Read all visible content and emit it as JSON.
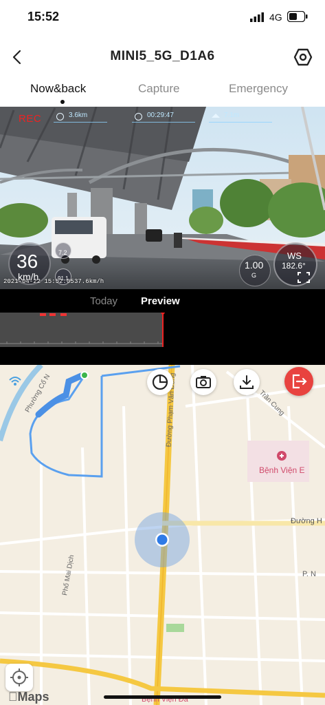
{
  "status_bar": {
    "time": "15:52",
    "network": "4G"
  },
  "header": {
    "title": "MINI5_5G_D1A6"
  },
  "tabs": [
    {
      "label": "Now&back",
      "active": true
    },
    {
      "label": "Capture",
      "active": false
    },
    {
      "label": "Emergency",
      "active": false
    }
  ],
  "video": {
    "rec_label": "REC",
    "distance": "3.6km",
    "elapsed": "00:29:47",
    "altitude": "7.1m",
    "speed": "36",
    "speed_unit": "km/h",
    "small_gauge_a": "7.2",
    "small_gauge_b": "91.1",
    "timestamp": "2021-04-22 15:52:05",
    "speed_text": "37.6km/h",
    "gforce": "1.00",
    "gforce_unit": "G",
    "compass_direction": "WS",
    "compass_heading": "182.6°"
  },
  "timeline": {
    "today_label": "Today",
    "preview_label": "Preview"
  },
  "map": {
    "labels": {
      "pham_van_dong": "Đường Phạm Văn Đồng",
      "tran_cung": "Trần Cung",
      "benh_vien_e": "Bệnh Viện E",
      "duong_h": "Đường H",
      "pho_mai_dich": "Phố Mai Dịch",
      "phuong_co_nhue": "Phường Cổ N",
      "pn": "P. N",
      "benh_vien_da": "Bệnh Viện Đa"
    },
    "logo": "Maps"
  },
  "colors": {
    "rec": "#e22222",
    "accent": "#4a90e2",
    "exit": "#e8433f",
    "route": "#5aa0ef",
    "highway": "#f5c842"
  }
}
